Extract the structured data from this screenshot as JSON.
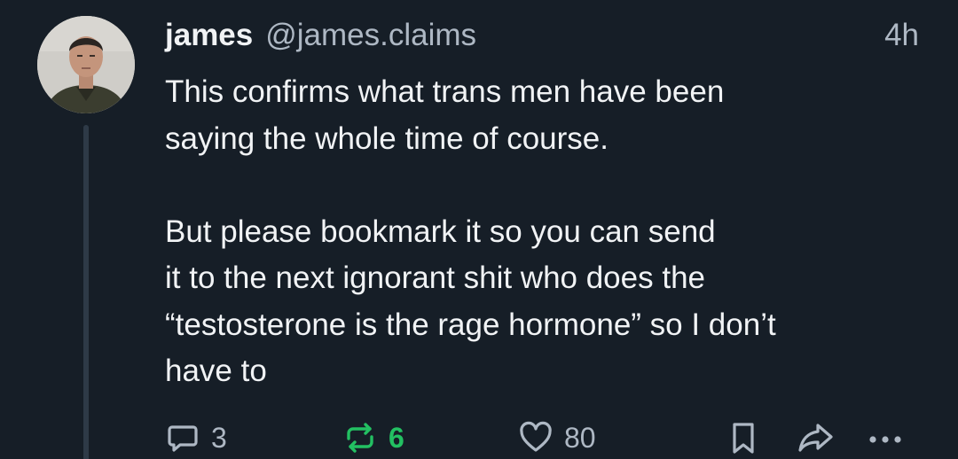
{
  "author": {
    "display_name": "james",
    "handle": "@james.claims"
  },
  "timestamp": "4h",
  "body": {
    "paragraph1": [
      "This confirms what trans men have been",
      "saying the whole time of course."
    ],
    "paragraph2": [
      "But please bookmark it so you can send",
      "it to the next ignorant shit who does the",
      "“testosterone is the rage hormone” so I don’t",
      "have to"
    ]
  },
  "actions": {
    "reply_count": "3",
    "repost_count": "6",
    "like_count": "80",
    "repost_active": true
  },
  "icons": {
    "reply": "speech-bubble-icon",
    "repost": "repost-arrows-icon",
    "like": "heart-icon",
    "bookmark": "bookmark-icon",
    "share": "share-arrow-icon",
    "more": "more-dots-icon"
  },
  "colors": {
    "background": "#161e27",
    "text_primary": "#f1f3f5",
    "text_secondary": "#aeb8c4",
    "repost_active": "#23c062",
    "thread_line": "#2e3a47"
  }
}
